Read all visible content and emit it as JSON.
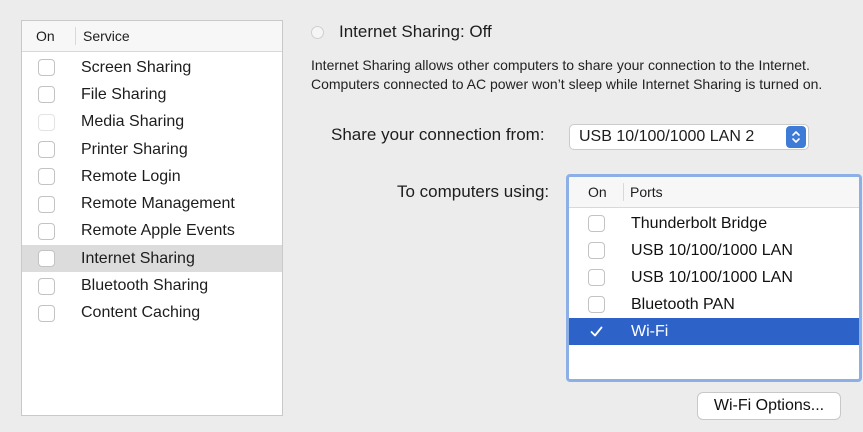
{
  "services": {
    "header_on": "On",
    "header_service": "Service",
    "items": [
      {
        "label": "Screen Sharing",
        "checked": false
      },
      {
        "label": "File Sharing",
        "checked": false
      },
      {
        "label": "Media Sharing",
        "checked": false
      },
      {
        "label": "Printer Sharing",
        "checked": false
      },
      {
        "label": "Remote Login",
        "checked": false
      },
      {
        "label": "Remote Management",
        "checked": false
      },
      {
        "label": "Remote Apple Events",
        "checked": false
      },
      {
        "label": "Internet Sharing",
        "checked": false,
        "selected": true
      },
      {
        "label": "Bluetooth Sharing",
        "checked": false
      },
      {
        "label": "Content Caching",
        "checked": false
      }
    ]
  },
  "detail": {
    "title": "Internet Sharing: Off",
    "description": "Internet Sharing allows other computers to share your connection to the Internet. Computers connected to AC power won’t sleep while Internet Sharing is turned on.",
    "share_from_label": "Share your connection from:",
    "share_from_value": "USB 10/100/1000 LAN 2",
    "to_computers_label": "To computers using:",
    "ports_header_on": "On",
    "ports_header_ports": "Ports",
    "ports": [
      {
        "label": "Thunderbolt Bridge",
        "checked": false
      },
      {
        "label": "USB 10/100/1000 LAN",
        "checked": false
      },
      {
        "label": "USB 10/100/1000 LAN",
        "checked": false
      },
      {
        "label": "Bluetooth PAN",
        "checked": false
      },
      {
        "label": "Wi-Fi",
        "checked": true,
        "selected": true
      }
    ],
    "wifi_options_button": "Wi-Fi Options..."
  },
  "colors": {
    "selection_blue": "#2d63c8",
    "focus_ring": "#8cb0e6",
    "stepper_blue": "#3e7bd7"
  },
  "icons": {
    "status_radio": "radio-off-icon",
    "select_stepper": "chevron-updown-icon",
    "checked": "checkmark-icon"
  }
}
